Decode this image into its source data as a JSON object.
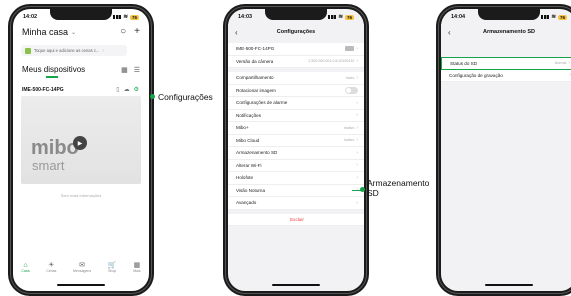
{
  "screen1": {
    "time": "14:02",
    "battery": "76",
    "home_title": "Minha casa",
    "banner": "Toque aqui e adicione as cenas c...",
    "devices_title": "Meus dispositivos",
    "camera_name": "IME-500-FC-14PG",
    "logo_top": "mibo",
    "logo_bottom": "smart",
    "no_more": "Sem mais informações",
    "tabs": [
      {
        "label": "Casa",
        "icon": "home-icon",
        "glyph": "⌂"
      },
      {
        "label": "Cenas",
        "icon": "bulb-icon",
        "glyph": "☀"
      },
      {
        "label": "Mensagens",
        "icon": "message-icon",
        "glyph": "✉"
      },
      {
        "label": "Shop",
        "icon": "cart-icon",
        "glyph": "🛒"
      },
      {
        "label": "Mais",
        "icon": "grid-icon",
        "glyph": "▦"
      }
    ]
  },
  "screen2": {
    "time": "14:03",
    "battery": "76",
    "title": "Configurações",
    "rows": [
      {
        "label": "IME-500-FC-14PG",
        "value": "",
        "kind": "mibo"
      },
      {
        "label": "Versão da câmera",
        "value": "2.500.000.001.0.8.20190410",
        "kind": "text"
      },
      {
        "label": "",
        "kind": "gap"
      },
      {
        "label": "Compartilhamento",
        "value": "Vazio",
        "kind": "text"
      },
      {
        "label": "Rotacionar imagem",
        "value": "",
        "kind": "toggle"
      },
      {
        "label": "Configurações de alarme",
        "value": "",
        "kind": "chev"
      },
      {
        "label": "Notificações",
        "value": "",
        "kind": "chev"
      },
      {
        "label": "Mibo+",
        "value": "Inativo",
        "kind": "text"
      },
      {
        "label": "Mibo Cloud",
        "value": "Inativo",
        "kind": "text"
      },
      {
        "label": "Armazenamento SD",
        "value": "",
        "kind": "chev"
      },
      {
        "label": "Alterar Wi-Fi",
        "value": "",
        "kind": "chev"
      },
      {
        "label": "Holofote",
        "value": "",
        "kind": "chev"
      },
      {
        "label": "Visão Noturna",
        "value": "",
        "kind": "chev"
      },
      {
        "label": "Avançado",
        "value": "",
        "kind": "chev"
      },
      {
        "label": "",
        "kind": "gap"
      },
      {
        "label": "Excluir",
        "value": "",
        "kind": "delete"
      }
    ]
  },
  "screen3": {
    "time": "14:04",
    "battery": "76",
    "title": "Armazenamento SD",
    "rows": [
      {
        "label": "Status do SD",
        "value": "Normal",
        "kind": "text",
        "highlight": true
      },
      {
        "label": "Configuração de gravação",
        "value": "",
        "kind": "chev"
      }
    ]
  },
  "callouts": {
    "config": "Configurações",
    "sd_line1": "Armazenamento",
    "sd_line2": "SD"
  },
  "colors": {
    "accent": "#17a34a",
    "danger": "#e53935"
  }
}
